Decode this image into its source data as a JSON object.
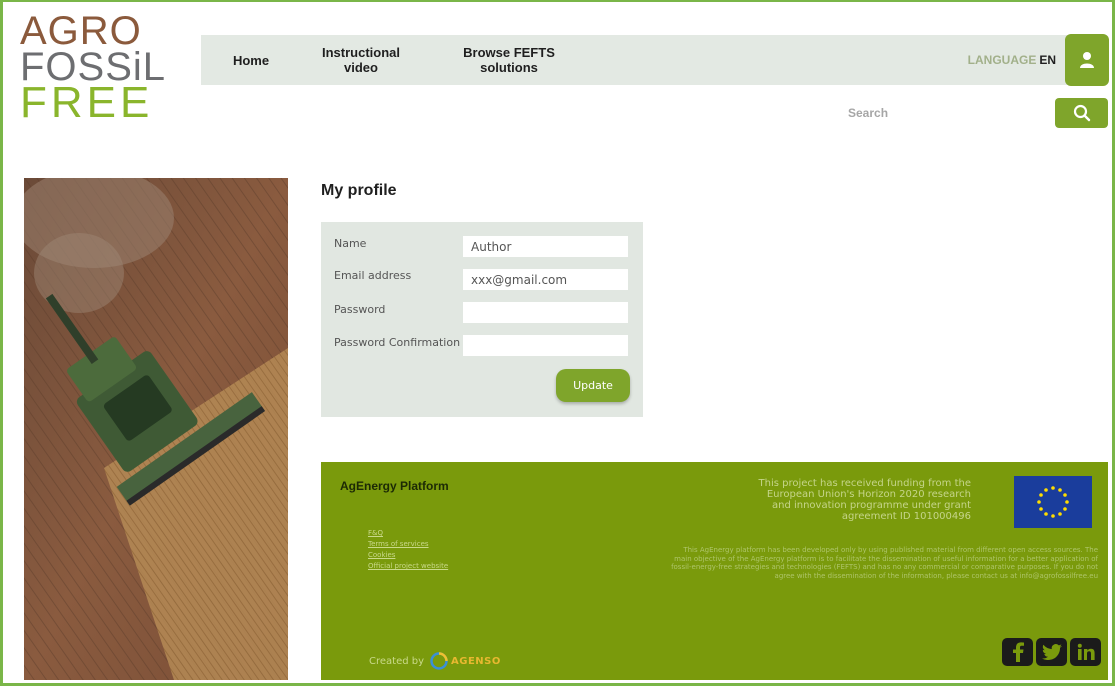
{
  "logo": {
    "line1": "AGRO",
    "line2": "FOSSiL",
    "line3": "FREE"
  },
  "nav": {
    "home": "Home",
    "video": "Instructional video",
    "browse": "Browse FEFTS solutions",
    "language_label": "LANGUAGE",
    "language_value": "EN"
  },
  "search": {
    "placeholder": "Search",
    "icon": "search-icon"
  },
  "profile": {
    "title": "My profile",
    "fields": {
      "name_label": "Name",
      "name_value": "Author",
      "email_label": "Email address",
      "email_value": "xxx@gmail.com",
      "password_label": "Password",
      "password_value": "",
      "password_confirmation_label": "Password Confirmation",
      "password_confirmation_value": ""
    },
    "update_label": "Update"
  },
  "footer": {
    "title": "AgEnergy Platform",
    "links": [
      "F&Q",
      "Terms of services",
      "Cookies",
      "Official project website"
    ],
    "funding_text": "This project has received funding from the European Union's Horizon 2020 research and innovation programme under grant agreement ID 101000496",
    "disclaimer": "This AgEnergy platform has been developed only by using published material from different open access sources. The main objective of the AgEnergy platform is to facilitate the dissemination of useful information for a better application of fossil-energy-free strategies and technologies (FEFTS) and has no any commercial or comparative purposes. If you do not agree with the dissemination of the information, please contact us at info@agrofossilfree.eu",
    "social": [
      "facebook-icon",
      "twitter-icon",
      "linkedin-icon"
    ],
    "created_by": "Created by",
    "created_brand": "AGENSO"
  },
  "colors": {
    "brand_green": "#7fa52b",
    "footer_green": "#7a9a0c",
    "frame_green": "#7ab648",
    "nav_bg": "#e3e9e3"
  }
}
